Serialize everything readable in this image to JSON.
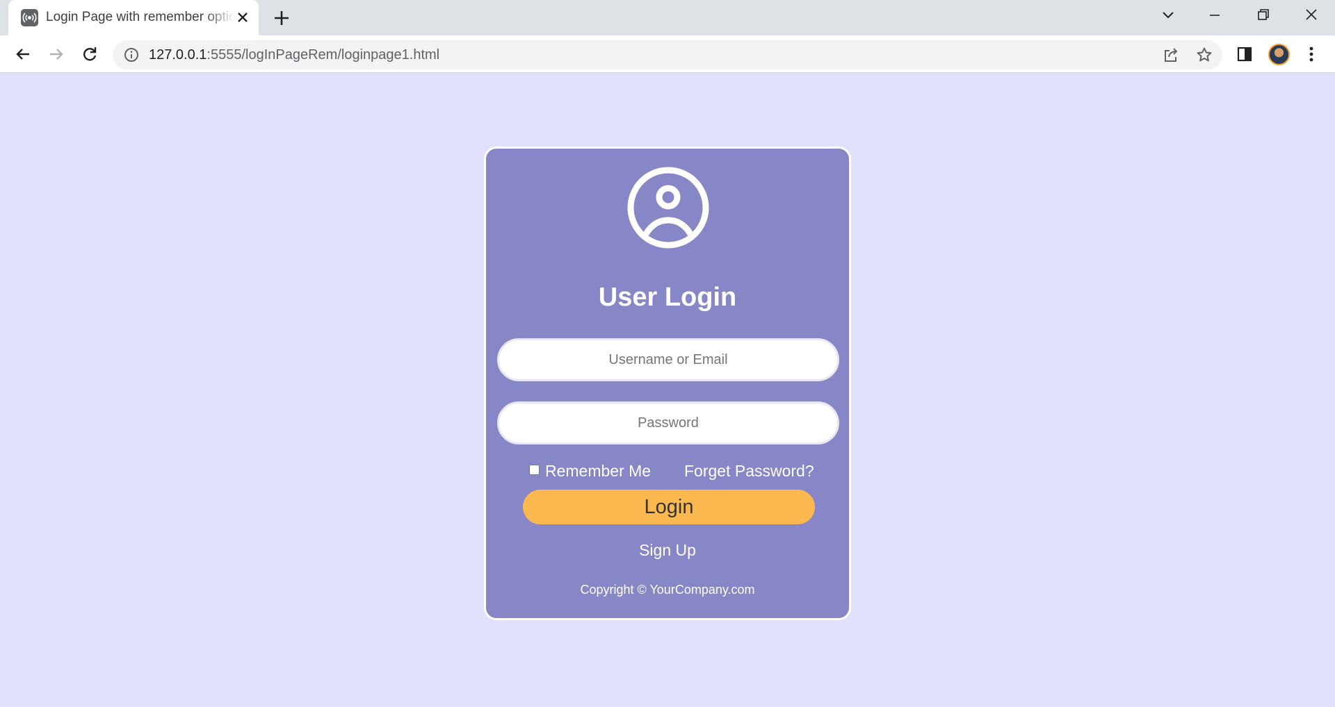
{
  "browser": {
    "tab_title": "Login Page with remember option",
    "url_host": "127.0.0.1",
    "url_rest": ":5555/logInPageRem/loginpage1.html"
  },
  "login": {
    "title": "User Login",
    "username_placeholder": "Username or Email",
    "password_placeholder": "Password",
    "remember_label": "Remember Me",
    "remember_checked": false,
    "forgot_label": "Forget Password?",
    "login_label": "Login",
    "signup_label": "Sign Up",
    "copyright": "Copyright © YourCompany.com"
  },
  "colors": {
    "page_bg": "#e1e1fd",
    "card_bg": "#8786c6",
    "button_bg": "#fbb84f",
    "text": "#ffffff"
  },
  "icons": {
    "tab": "broadcast-icon",
    "user": "user-circle-icon"
  }
}
